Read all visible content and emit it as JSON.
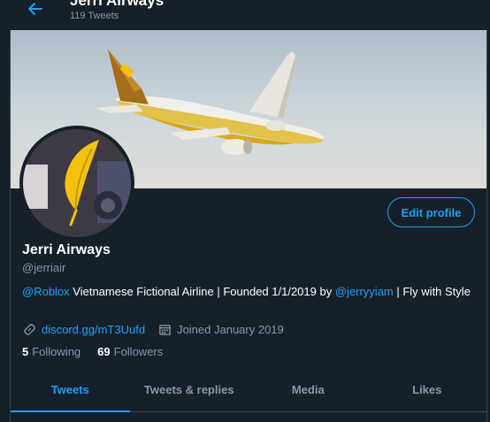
{
  "header": {
    "title": "Jerri Airways",
    "subtitle": "119 Tweets"
  },
  "profile": {
    "name": "Jerri Airways",
    "handle": "@jerriair",
    "edit_label": "Edit profile",
    "bio": {
      "mention1": "@Roblox",
      "text1": " Vietnamese Fictional Airline | Founded 1/1/2019 by ",
      "mention2": "@jerryyiam",
      "text2": " | Fly with Style"
    },
    "website": "discord.gg/mT3Uufd",
    "joined": "Joined January 2019",
    "following_count": "5",
    "following_label": "Following",
    "followers_count": "69",
    "followers_label": "Followers"
  },
  "tabs": [
    {
      "label": "Tweets"
    },
    {
      "label": "Tweets & replies"
    },
    {
      "label": "Media"
    },
    {
      "label": "Likes"
    }
  ],
  "colors": {
    "background": "#15202b",
    "accent": "#1da1f2",
    "secondary_text": "#8899a6",
    "airline_gold": "#f4c20d"
  }
}
